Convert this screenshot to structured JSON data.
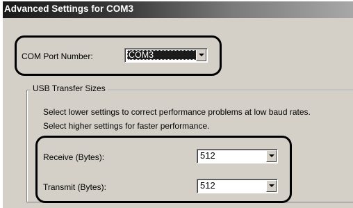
{
  "window": {
    "title": "Advanced Settings for COM3"
  },
  "com_port": {
    "label": "COM Port Number:",
    "value": "COM3"
  },
  "usb_transfer": {
    "group_title": "USB Transfer Sizes",
    "description_1": "Select lower settings to correct performance problems at low baud rates.",
    "description_2": "Select higher settings for faster performance.",
    "receive_label": "Receive (Bytes):",
    "receive_value": "512",
    "transmit_label": "Transmit (Bytes):",
    "transmit_value": "512"
  }
}
